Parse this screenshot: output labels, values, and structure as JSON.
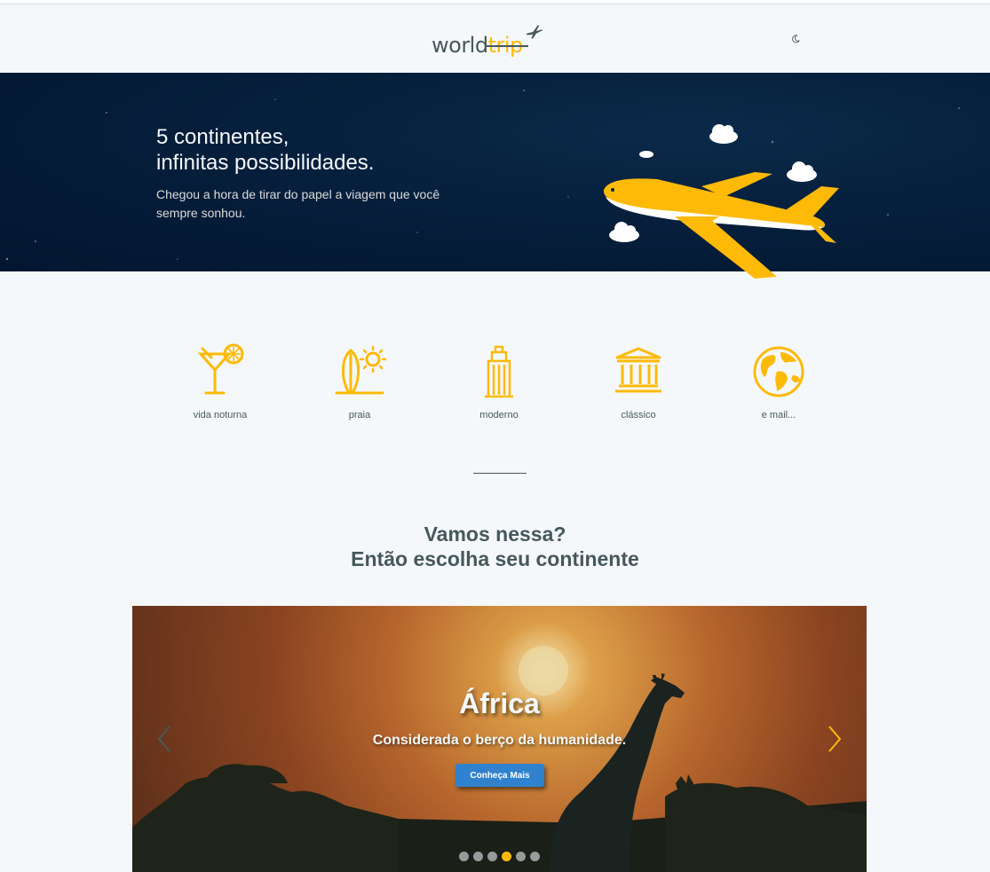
{
  "header": {
    "logo_part1": "world",
    "logo_part2": "trip"
  },
  "banner": {
    "title_line1": "5 continentes,",
    "title_line2": "infinitas possibilidades.",
    "subtitle": "Chegou a hora de tirar do papel a viagem que você sempre sonhou."
  },
  "types": [
    {
      "label": "vida noturna",
      "icon": "cocktail-icon"
    },
    {
      "label": "praia",
      "icon": "surfboard-sun-icon"
    },
    {
      "label": "moderno",
      "icon": "building-icon"
    },
    {
      "label": "clássico",
      "icon": "museum-icon"
    },
    {
      "label": "e mail...",
      "icon": "globe-icon"
    }
  ],
  "cta": {
    "line1": "Vamos nessa?",
    "line2": "Então escolha seu continente"
  },
  "slider": {
    "title": "África",
    "subtitle": "Considerada o berço da humanidade.",
    "button_label": "Conheça Mais",
    "slide_count": 6,
    "active_index": 3
  },
  "colors": {
    "accent": "#ffba08",
    "text": "#47585b",
    "background": "#f5f8fa",
    "button": "#3182ce"
  }
}
